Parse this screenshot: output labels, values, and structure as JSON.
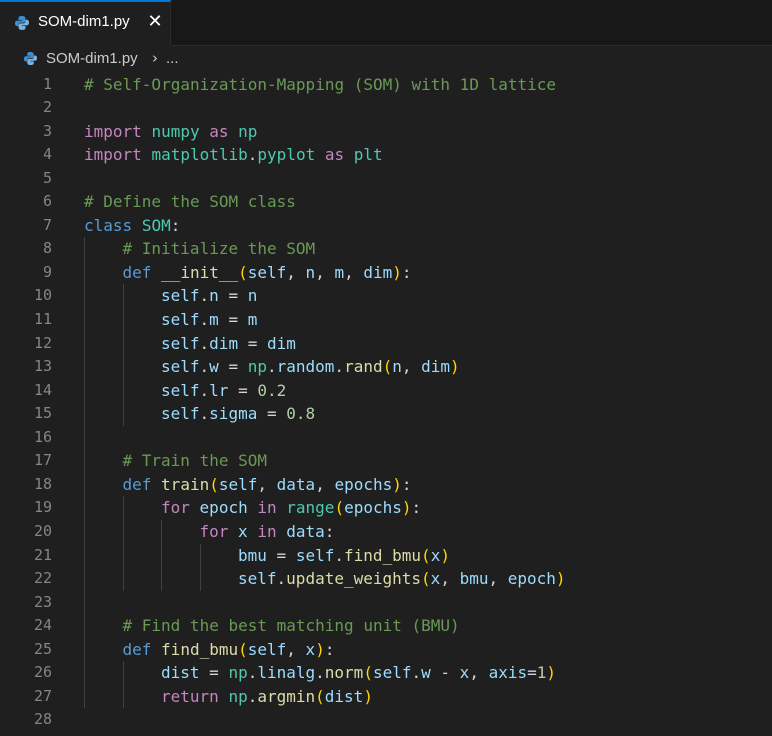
{
  "tab": {
    "label": "SOM-dim1.py",
    "close_glyph": "✕",
    "icon": "python-file-icon"
  },
  "breadcrumb": {
    "file_label": "SOM-dim1.py",
    "chevron": "›",
    "ellipsis": "..."
  },
  "colors": {
    "background": "#1f1f1f",
    "tab_accent": "#0078d4",
    "comment": "#6a9955",
    "keyword": "#569cd6",
    "control": "#c586c0",
    "function": "#dcdcaa",
    "variable": "#9cdcfe",
    "number": "#b5cea8",
    "class": "#4ec9b0"
  },
  "editor": {
    "lines": [
      {
        "n": "1",
        "indent": 0,
        "tokens": [
          [
            "comment",
            "# Self-Organization-Mapping (SOM) with 1D lattice"
          ]
        ]
      },
      {
        "n": "2",
        "indent": 0,
        "tokens": []
      },
      {
        "n": "3",
        "indent": 0,
        "tokens": [
          [
            "import",
            "import"
          ],
          [
            "text",
            " "
          ],
          [
            "mod",
            "numpy"
          ],
          [
            "text",
            " "
          ],
          [
            "import",
            "as"
          ],
          [
            "text",
            " "
          ],
          [
            "mod",
            "np"
          ]
        ]
      },
      {
        "n": "4",
        "indent": 0,
        "tokens": [
          [
            "import",
            "import"
          ],
          [
            "text",
            " "
          ],
          [
            "mod",
            "matplotlib"
          ],
          [
            "text",
            "."
          ],
          [
            "mod",
            "pyplot"
          ],
          [
            "text",
            " "
          ],
          [
            "import",
            "as"
          ],
          [
            "text",
            " "
          ],
          [
            "mod",
            "plt"
          ]
        ]
      },
      {
        "n": "5",
        "indent": 0,
        "tokens": []
      },
      {
        "n": "6",
        "indent": 0,
        "tokens": [
          [
            "comment",
            "# Define the SOM class"
          ]
        ]
      },
      {
        "n": "7",
        "indent": 0,
        "tokens": [
          [
            "kw",
            "class"
          ],
          [
            "text",
            " "
          ],
          [
            "cls",
            "SOM"
          ],
          [
            "text",
            ":"
          ]
        ]
      },
      {
        "n": "8",
        "indent": 1,
        "tokens": [
          [
            "comment",
            "# Initialize the SOM"
          ]
        ]
      },
      {
        "n": "9",
        "indent": 1,
        "tokens": [
          [
            "kw",
            "def"
          ],
          [
            "text",
            " "
          ],
          [
            "func",
            "__init__"
          ],
          [
            "bracket1",
            "("
          ],
          [
            "var",
            "self"
          ],
          [
            "text",
            ", "
          ],
          [
            "var",
            "n"
          ],
          [
            "text",
            ", "
          ],
          [
            "var",
            "m"
          ],
          [
            "text",
            ", "
          ],
          [
            "var",
            "dim"
          ],
          [
            "bracket1",
            ")"
          ],
          [
            "text",
            ":"
          ]
        ]
      },
      {
        "n": "10",
        "indent": 2,
        "tokens": [
          [
            "var",
            "self"
          ],
          [
            "text",
            "."
          ],
          [
            "var",
            "n"
          ],
          [
            "text",
            " = "
          ],
          [
            "var",
            "n"
          ]
        ]
      },
      {
        "n": "11",
        "indent": 2,
        "tokens": [
          [
            "var",
            "self"
          ],
          [
            "text",
            "."
          ],
          [
            "var",
            "m"
          ],
          [
            "text",
            " = "
          ],
          [
            "var",
            "m"
          ]
        ]
      },
      {
        "n": "12",
        "indent": 2,
        "tokens": [
          [
            "var",
            "self"
          ],
          [
            "text",
            "."
          ],
          [
            "var",
            "dim"
          ],
          [
            "text",
            " = "
          ],
          [
            "var",
            "dim"
          ]
        ]
      },
      {
        "n": "13",
        "indent": 2,
        "tokens": [
          [
            "var",
            "self"
          ],
          [
            "text",
            "."
          ],
          [
            "var",
            "w"
          ],
          [
            "text",
            " = "
          ],
          [
            "mod",
            "np"
          ],
          [
            "text",
            "."
          ],
          [
            "var",
            "random"
          ],
          [
            "text",
            "."
          ],
          [
            "func",
            "rand"
          ],
          [
            "bracket1",
            "("
          ],
          [
            "var",
            "n"
          ],
          [
            "text",
            ", "
          ],
          [
            "var",
            "dim"
          ],
          [
            "bracket1",
            ")"
          ]
        ]
      },
      {
        "n": "14",
        "indent": 2,
        "tokens": [
          [
            "var",
            "self"
          ],
          [
            "text",
            "."
          ],
          [
            "var",
            "lr"
          ],
          [
            "text",
            " = "
          ],
          [
            "num",
            "0.2"
          ]
        ]
      },
      {
        "n": "15",
        "indent": 2,
        "tokens": [
          [
            "var",
            "self"
          ],
          [
            "text",
            "."
          ],
          [
            "var",
            "sigma"
          ],
          [
            "text",
            " = "
          ],
          [
            "num",
            "0.8"
          ]
        ]
      },
      {
        "n": "16",
        "indent": 0,
        "tokens": []
      },
      {
        "n": "17",
        "indent": 1,
        "tokens": [
          [
            "comment",
            "# Train the SOM"
          ]
        ]
      },
      {
        "n": "18",
        "indent": 1,
        "tokens": [
          [
            "kw",
            "def"
          ],
          [
            "text",
            " "
          ],
          [
            "func",
            "train"
          ],
          [
            "bracket1",
            "("
          ],
          [
            "var",
            "self"
          ],
          [
            "text",
            ", "
          ],
          [
            "var",
            "data"
          ],
          [
            "text",
            ", "
          ],
          [
            "var",
            "epochs"
          ],
          [
            "bracket1",
            ")"
          ],
          [
            "text",
            ":"
          ]
        ]
      },
      {
        "n": "19",
        "indent": 2,
        "tokens": [
          [
            "ctrl",
            "for"
          ],
          [
            "text",
            " "
          ],
          [
            "var",
            "epoch"
          ],
          [
            "text",
            " "
          ],
          [
            "ctrl",
            "in"
          ],
          [
            "text",
            " "
          ],
          [
            "cls",
            "range"
          ],
          [
            "bracket1",
            "("
          ],
          [
            "var",
            "epochs"
          ],
          [
            "bracket1",
            ")"
          ],
          [
            "text",
            ":"
          ]
        ]
      },
      {
        "n": "20",
        "indent": 3,
        "tokens": [
          [
            "ctrl",
            "for"
          ],
          [
            "text",
            " "
          ],
          [
            "var",
            "x"
          ],
          [
            "text",
            " "
          ],
          [
            "ctrl",
            "in"
          ],
          [
            "text",
            " "
          ],
          [
            "var",
            "data"
          ],
          [
            "text",
            ":"
          ]
        ]
      },
      {
        "n": "21",
        "indent": 4,
        "tokens": [
          [
            "var",
            "bmu"
          ],
          [
            "text",
            " = "
          ],
          [
            "var",
            "self"
          ],
          [
            "text",
            "."
          ],
          [
            "func",
            "find_bmu"
          ],
          [
            "bracket1",
            "("
          ],
          [
            "var",
            "x"
          ],
          [
            "bracket1",
            ")"
          ]
        ]
      },
      {
        "n": "22",
        "indent": 4,
        "tokens": [
          [
            "var",
            "self"
          ],
          [
            "text",
            "."
          ],
          [
            "func",
            "update_weights"
          ],
          [
            "bracket1",
            "("
          ],
          [
            "var",
            "x"
          ],
          [
            "text",
            ", "
          ],
          [
            "var",
            "bmu"
          ],
          [
            "text",
            ", "
          ],
          [
            "var",
            "epoch"
          ],
          [
            "bracket1",
            ")"
          ]
        ]
      },
      {
        "n": "23",
        "indent": 0,
        "tokens": []
      },
      {
        "n": "24",
        "indent": 1,
        "tokens": [
          [
            "comment",
            "# Find the best matching unit (BMU)"
          ]
        ]
      },
      {
        "n": "25",
        "indent": 1,
        "tokens": [
          [
            "kw",
            "def"
          ],
          [
            "text",
            " "
          ],
          [
            "func",
            "find_bmu"
          ],
          [
            "bracket1",
            "("
          ],
          [
            "var",
            "self"
          ],
          [
            "text",
            ", "
          ],
          [
            "var",
            "x"
          ],
          [
            "bracket1",
            ")"
          ],
          [
            "text",
            ":"
          ]
        ]
      },
      {
        "n": "26",
        "indent": 2,
        "tokens": [
          [
            "var",
            "dist"
          ],
          [
            "text",
            " = "
          ],
          [
            "mod",
            "np"
          ],
          [
            "text",
            "."
          ],
          [
            "var",
            "linalg"
          ],
          [
            "text",
            "."
          ],
          [
            "func",
            "norm"
          ],
          [
            "bracket1",
            "("
          ],
          [
            "var",
            "self"
          ],
          [
            "text",
            "."
          ],
          [
            "var",
            "w"
          ],
          [
            "text",
            " - "
          ],
          [
            "var",
            "x"
          ],
          [
            "text",
            ", "
          ],
          [
            "var",
            "axis"
          ],
          [
            "text",
            "="
          ],
          [
            "num",
            "1"
          ],
          [
            "bracket1",
            ")"
          ]
        ]
      },
      {
        "n": "27",
        "indent": 2,
        "tokens": [
          [
            "ctrl",
            "return"
          ],
          [
            "text",
            " "
          ],
          [
            "mod",
            "np"
          ],
          [
            "text",
            "."
          ],
          [
            "func",
            "argmin"
          ],
          [
            "bracket1",
            "("
          ],
          [
            "var",
            "dist"
          ],
          [
            "bracket1",
            ")"
          ]
        ]
      },
      {
        "n": "28",
        "indent": 0,
        "tokens": []
      }
    ]
  }
}
